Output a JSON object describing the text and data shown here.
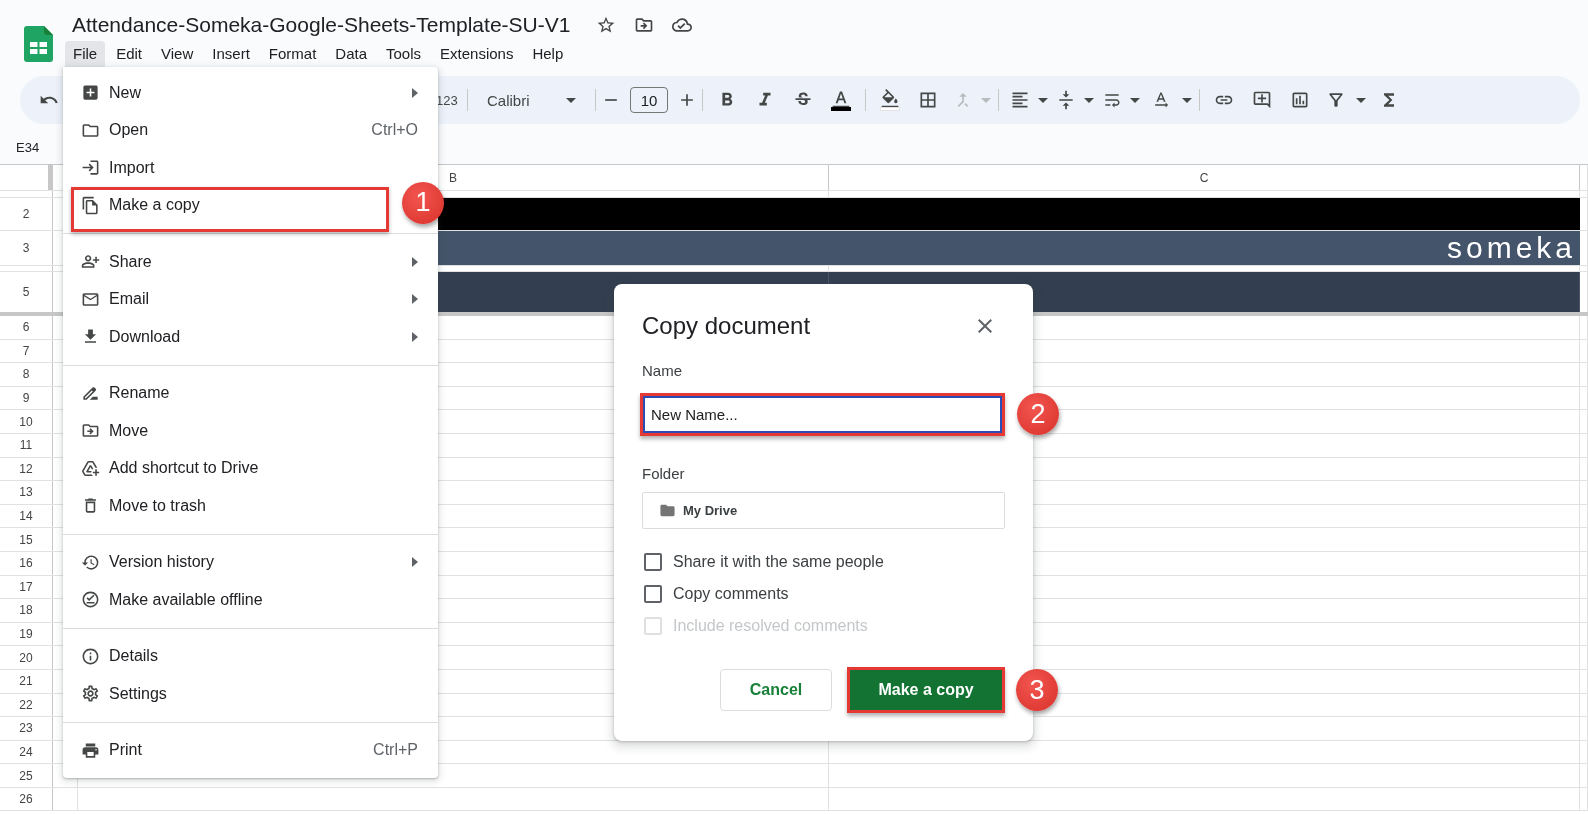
{
  "app": {
    "title": "Attendance-Someka-Google-Sheets-Template-SU-V1"
  },
  "menu_bar": [
    {
      "label": "File",
      "selected": true
    },
    {
      "label": "Edit",
      "selected": false
    },
    {
      "label": "View",
      "selected": false
    },
    {
      "label": "Insert",
      "selected": false
    },
    {
      "label": "Format",
      "selected": false
    },
    {
      "label": "Data",
      "selected": false
    },
    {
      "label": "Tools",
      "selected": false
    },
    {
      "label": "Extensions",
      "selected": false
    },
    {
      "label": "Help",
      "selected": false
    }
  ],
  "toolbar": {
    "number_format": "123",
    "font": "Calibri",
    "font_size": "10",
    "merge": {
      "disabled": true
    }
  },
  "name_box": "E34",
  "sheet": {
    "columns": [
      {
        "label": "B"
      },
      {
        "label": "C"
      }
    ],
    "rows": [
      {
        "kind": "thin"
      },
      {
        "kind": "title",
        "label": "2"
      },
      {
        "kind": "logo",
        "label": "3",
        "brand": "someka"
      },
      {
        "kind": "thin"
      },
      {
        "kind": "header",
        "label": "5"
      },
      {
        "kind": "plain",
        "label": "6"
      },
      {
        "kind": "plain",
        "label": "7"
      },
      {
        "kind": "plain",
        "label": "8"
      },
      {
        "kind": "plain",
        "label": "9"
      },
      {
        "kind": "plain",
        "label": "10"
      },
      {
        "kind": "plain",
        "label": "11"
      },
      {
        "kind": "plain",
        "label": "12"
      },
      {
        "kind": "plain",
        "label": "13"
      },
      {
        "kind": "plain",
        "label": "14"
      },
      {
        "kind": "plain",
        "label": "15"
      },
      {
        "kind": "plain",
        "label": "16"
      },
      {
        "kind": "plain",
        "label": "17"
      },
      {
        "kind": "plain",
        "label": "18"
      },
      {
        "kind": "plain",
        "label": "19"
      },
      {
        "kind": "plain",
        "label": "20"
      },
      {
        "kind": "plain",
        "label": "21"
      },
      {
        "kind": "plain",
        "label": "22"
      },
      {
        "kind": "plain",
        "label": "23"
      },
      {
        "kind": "plain",
        "label": "24"
      },
      {
        "kind": "plain",
        "label": "25"
      },
      {
        "kind": "plain",
        "label": "26"
      }
    ]
  },
  "file_menu": {
    "groups": [
      [
        {
          "label": "New",
          "submenu": true,
          "highlighted": false
        },
        {
          "label": "Open",
          "shortcut": "Ctrl+O",
          "submenu": false,
          "highlighted": false
        },
        {
          "label": "Import",
          "submenu": false,
          "highlighted": false
        },
        {
          "label": "Make a copy",
          "submenu": false,
          "highlighted": true,
          "callout": "1"
        }
      ],
      [
        {
          "label": "Share",
          "submenu": true,
          "highlighted": false
        },
        {
          "label": "Email",
          "submenu": true,
          "highlighted": false
        },
        {
          "label": "Download",
          "submenu": true,
          "highlighted": false
        }
      ],
      [
        {
          "label": "Rename",
          "submenu": false,
          "highlighted": false
        },
        {
          "label": "Move",
          "submenu": false,
          "highlighted": false
        },
        {
          "label": "Add shortcut to Drive",
          "submenu": false,
          "highlighted": false
        },
        {
          "label": "Move to trash",
          "submenu": false,
          "highlighted": false
        }
      ],
      [
        {
          "label": "Version history",
          "submenu": true,
          "highlighted": false
        },
        {
          "label": "Make available offline",
          "submenu": false,
          "highlighted": false
        }
      ],
      [
        {
          "label": "Details",
          "submenu": false,
          "highlighted": false
        },
        {
          "label": "Settings",
          "submenu": false,
          "highlighted": false
        }
      ],
      [
        {
          "label": "Print",
          "shortcut": "Ctrl+P",
          "submenu": false,
          "highlighted": false
        }
      ]
    ]
  },
  "dialog": {
    "title": "Copy document",
    "name_field": {
      "label": "Name",
      "value": "New Name...",
      "focused": true,
      "highlighted": true,
      "callout": "2"
    },
    "folder_field": {
      "label": "Folder",
      "value": "My Drive"
    },
    "options": [
      {
        "label": "Share it with the same people",
        "checked": false,
        "disabled": false
      },
      {
        "label": "Copy comments",
        "checked": false,
        "disabled": false
      },
      {
        "label": "Include resolved comments",
        "checked": false,
        "disabled": true
      }
    ],
    "buttons": [
      {
        "label": "Cancel",
        "kind": "secondary",
        "highlighted": false
      },
      {
        "label": "Make a copy",
        "kind": "primary",
        "highlighted": true,
        "callout": "3"
      }
    ]
  }
}
